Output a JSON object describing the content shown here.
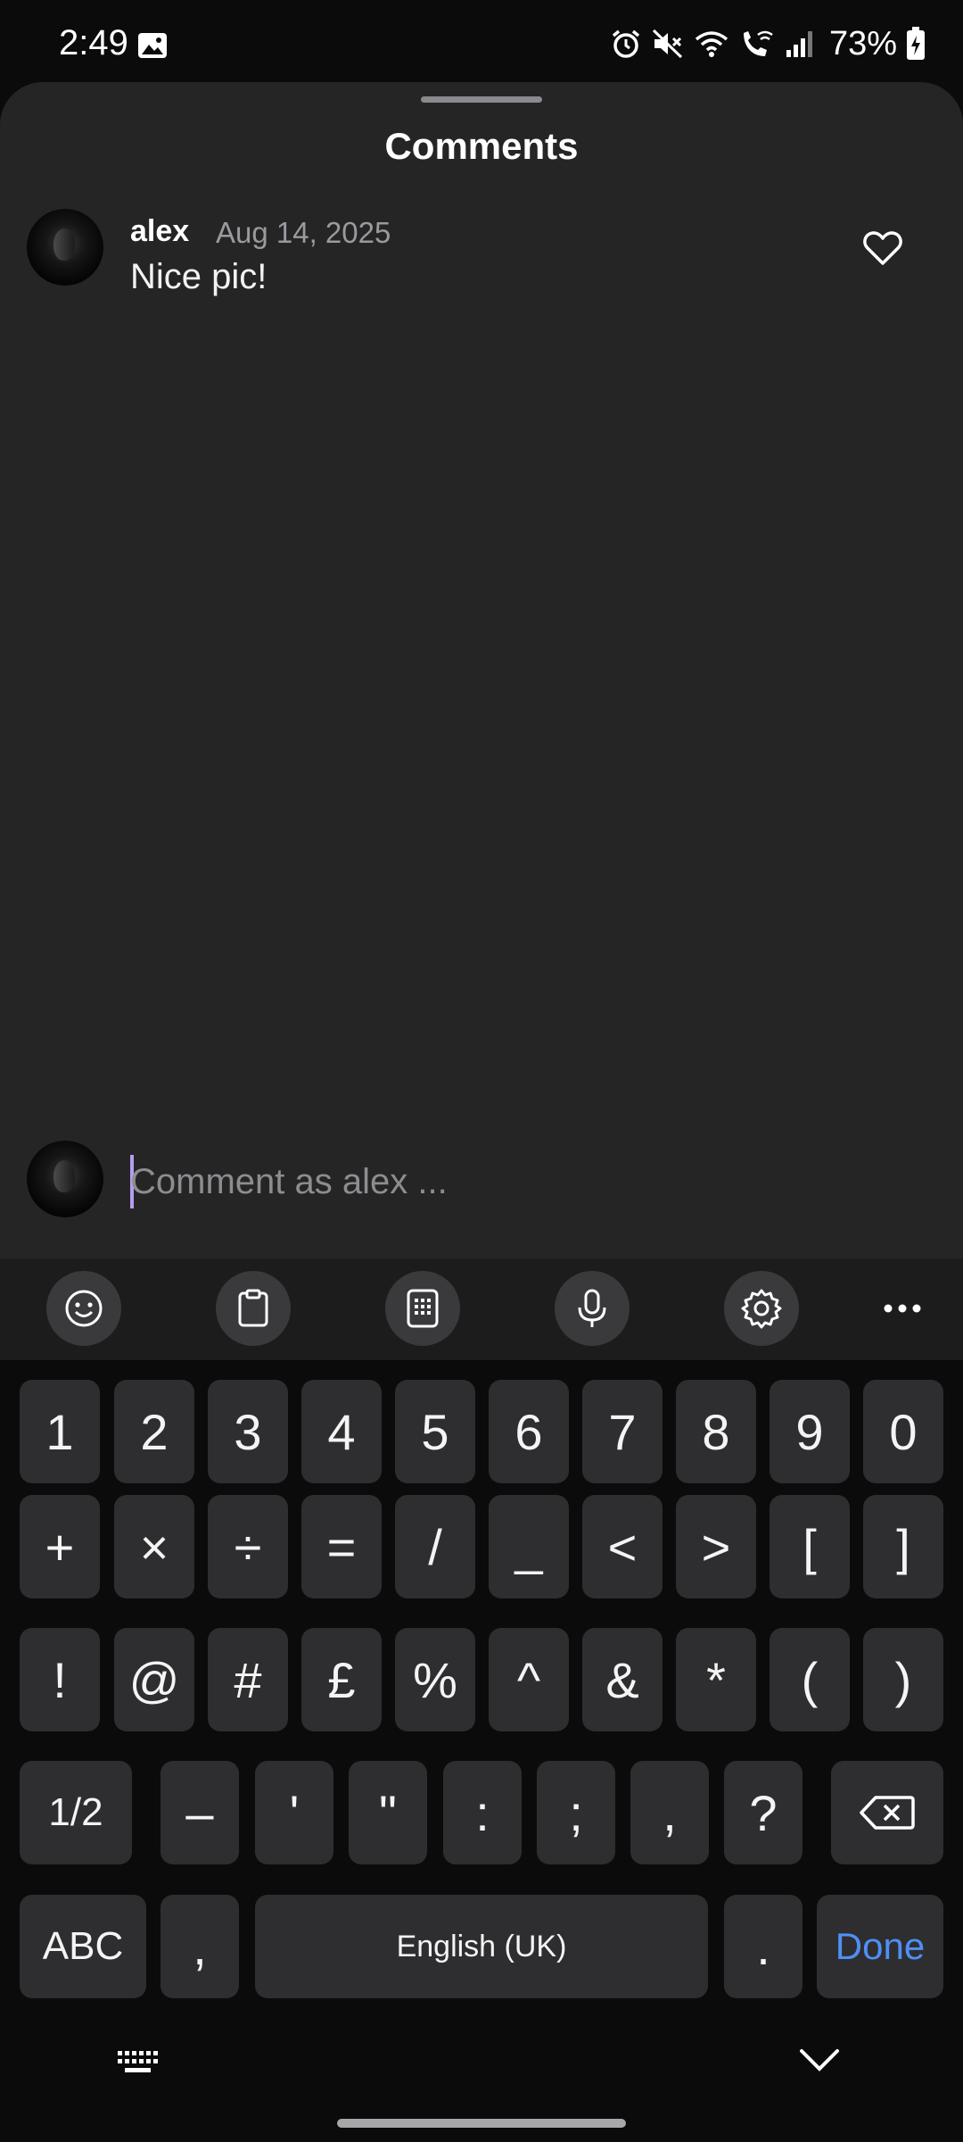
{
  "status_bar": {
    "time": "2:49",
    "battery": "73%",
    "icons": [
      "gallery-icon",
      "alarm-icon",
      "mute-icon",
      "wifi-icon",
      "wifi-calling-icon",
      "signal-icon",
      "battery-charging-icon"
    ]
  },
  "sheet": {
    "title": "Comments",
    "comments": [
      {
        "user": "alex",
        "date": "Aug 14, 2025",
        "text": "Nice pic!"
      }
    ],
    "input": {
      "placeholder": "Comment as alex ...",
      "value": ""
    }
  },
  "keyboard": {
    "toolbar": [
      "emoji-icon",
      "clipboard-icon",
      "keypad-icon",
      "microphone-icon",
      "settings-icon",
      "more-icon"
    ],
    "rows": [
      [
        "1",
        "2",
        "3",
        "4",
        "5",
        "6",
        "7",
        "8",
        "9",
        "0"
      ],
      [
        "+",
        "×",
        "÷",
        "=",
        "/",
        "_",
        "<",
        ">",
        "[",
        "]"
      ],
      [
        "!",
        "@",
        "#",
        "£",
        "%",
        "^",
        "&",
        "*",
        "(",
        ")"
      ],
      [
        "1/2",
        "–",
        "'",
        "\"",
        ":",
        ";",
        ",",
        "?"
      ],
      [
        "ABC",
        ",",
        "English (UK)",
        ".",
        "Done"
      ]
    ]
  },
  "colors": {
    "sheet_bg": "#252526",
    "key_bg": "#2e2e30",
    "accent": "#4f8ff5",
    "caret": "#b59cf0"
  }
}
